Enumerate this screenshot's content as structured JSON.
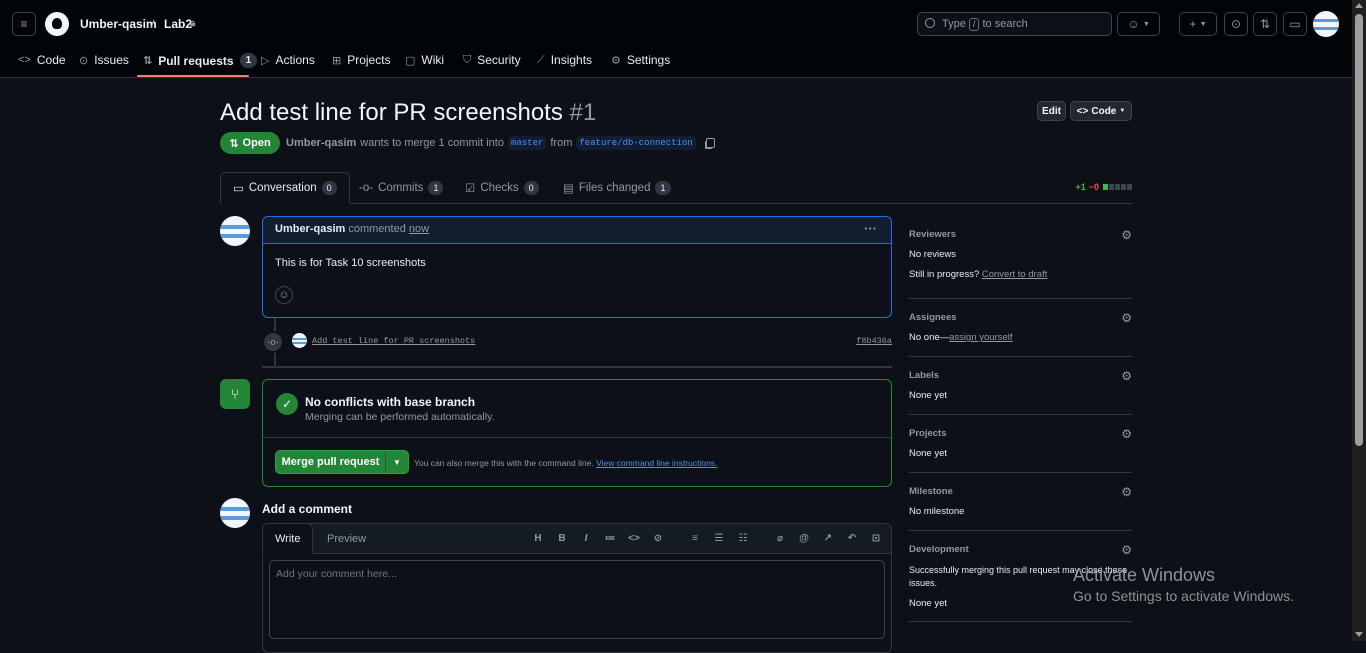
{
  "header": {
    "owner": "Umber-qasim",
    "separator": "/",
    "repo": "Lab2",
    "search_pre": "Type",
    "search_key": "/",
    "search_post": "to search"
  },
  "nav": {
    "code": "Code",
    "issues": "Issues",
    "pulls": "Pull requests",
    "pulls_count": "1",
    "actions": "Actions",
    "projects": "Projects",
    "wiki": "Wiki",
    "security": "Security",
    "insights": "Insights",
    "settings": "Settings"
  },
  "pr": {
    "title": "Add test line for PR screenshots",
    "number": "#1",
    "edit_label": "Edit",
    "code_label": "Code",
    "state": "Open",
    "author": "Umber-qasim",
    "meta_text": "wants to merge 1 commit into",
    "base": "master",
    "from": "from",
    "head": "feature/db-connection"
  },
  "tabs": {
    "conversation": "Conversation",
    "conversation_count": "0",
    "commits": "Commits",
    "commits_count": "1",
    "checks": "Checks",
    "checks_count": "0",
    "files": "Files changed",
    "files_count": "1",
    "additions": "+1",
    "deletions": "−0"
  },
  "comment": {
    "author": "Umber-qasim",
    "action": "commented",
    "time": "now",
    "body": "This is for Task 10 screenshots"
  },
  "commit": {
    "message": "Add test line for PR screenshots",
    "sha": "f8b436a"
  },
  "merge": {
    "title": "No conflicts with base branch",
    "subtitle": "Merging can be performed automatically.",
    "button": "Merge pull request",
    "hint": "You can also merge this with the command line.",
    "hint_link": "View command line instructions."
  },
  "new_comment": {
    "title": "Add a comment",
    "write": "Write",
    "preview": "Preview",
    "placeholder": "Add your comment here..."
  },
  "sidebar": {
    "reviewers": "Reviewers",
    "reviewers_value": "No reviews",
    "in_progress": "Still in progress?",
    "convert": "Convert to draft",
    "assignees": "Assignees",
    "assignees_value": "No one—",
    "assign_yourself": "assign yourself",
    "labels": "Labels",
    "labels_value": "None yet",
    "projects": "Projects",
    "projects_value": "None yet",
    "milestone": "Milestone",
    "milestone_value": "No milestone",
    "development": "Development",
    "development_text": "Successfully merging this pull request may close these issues.",
    "development_value": "None yet"
  },
  "watermark": {
    "line1": "Activate Windows",
    "line2": "Go to Settings to activate Windows."
  },
  "colors": {
    "accent_green": "#238636",
    "link_blue": "#4493f8",
    "tab_underline": "#f78166"
  }
}
